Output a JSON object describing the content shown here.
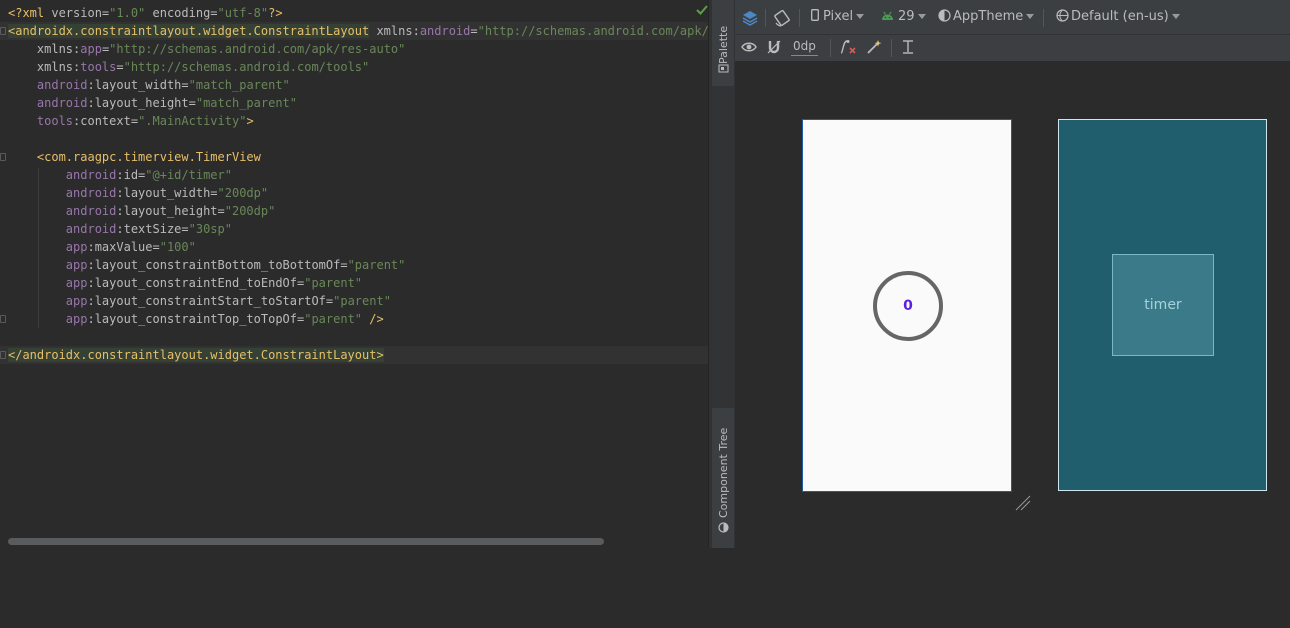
{
  "editor": {
    "lines": [
      [
        {
          "t": "<?xml ",
          "c": "t-pi"
        },
        {
          "t": "version=",
          "c": "t-attr"
        },
        {
          "t": "\"1.0\"",
          "c": "t-val"
        },
        {
          "t": " encoding=",
          "c": "t-attr"
        },
        {
          "t": "\"utf-8\"",
          "c": "t-val"
        },
        {
          "t": "?>",
          "c": "t-pi"
        }
      ],
      [
        {
          "t": "<androidx.constraintlayout.widget.ConstraintLayout",
          "c": "t-tag tag-hl"
        },
        {
          "t": " xmlns:",
          "c": "t-attr"
        },
        {
          "t": "android",
          "c": "t-ns"
        },
        {
          "t": "=",
          "c": "t-attr"
        },
        {
          "t": "\"http://schemas.android.com/apk/res",
          "c": "t-val"
        }
      ],
      [
        {
          "t": "    xmlns:",
          "c": "t-attr"
        },
        {
          "t": "app",
          "c": "t-ns"
        },
        {
          "t": "=",
          "c": "t-attr"
        },
        {
          "t": "\"http://schemas.android.com/apk/res-auto\"",
          "c": "t-val"
        }
      ],
      [
        {
          "t": "    xmlns:",
          "c": "t-attr"
        },
        {
          "t": "tools",
          "c": "t-ns"
        },
        {
          "t": "=",
          "c": "t-attr"
        },
        {
          "t": "\"http://schemas.android.com/tools\"",
          "c": "t-val"
        }
      ],
      [
        {
          "t": "    ",
          "c": "t-attr"
        },
        {
          "t": "android",
          "c": "t-ns"
        },
        {
          "t": ":layout_width=",
          "c": "t-attr"
        },
        {
          "t": "\"match_parent\"",
          "c": "t-val"
        }
      ],
      [
        {
          "t": "    ",
          "c": "t-attr"
        },
        {
          "t": "android",
          "c": "t-ns"
        },
        {
          "t": ":layout_height=",
          "c": "t-attr"
        },
        {
          "t": "\"match_parent\"",
          "c": "t-val"
        }
      ],
      [
        {
          "t": "    ",
          "c": "t-attr"
        },
        {
          "t": "tools",
          "c": "t-ns"
        },
        {
          "t": ":context=",
          "c": "t-attr"
        },
        {
          "t": "\".MainActivity\"",
          "c": "t-val"
        },
        {
          "t": ">",
          "c": "t-tag"
        }
      ],
      [],
      [
        {
          "t": "    ",
          "c": "t-attr"
        },
        {
          "t": "<com.raagpc.timerview.TimerView",
          "c": "t-tag"
        }
      ],
      [
        {
          "t": "        ",
          "c": "t-attr"
        },
        {
          "t": "android",
          "c": "t-ns"
        },
        {
          "t": ":id=",
          "c": "t-attr"
        },
        {
          "t": "\"@+id/timer\"",
          "c": "t-val"
        }
      ],
      [
        {
          "t": "        ",
          "c": "t-attr"
        },
        {
          "t": "android",
          "c": "t-ns"
        },
        {
          "t": ":layout_width=",
          "c": "t-attr"
        },
        {
          "t": "\"200dp\"",
          "c": "t-val"
        }
      ],
      [
        {
          "t": "        ",
          "c": "t-attr"
        },
        {
          "t": "android",
          "c": "t-ns"
        },
        {
          "t": ":layout_height=",
          "c": "t-attr"
        },
        {
          "t": "\"200dp\"",
          "c": "t-val"
        }
      ],
      [
        {
          "t": "        ",
          "c": "t-attr"
        },
        {
          "t": "android",
          "c": "t-ns"
        },
        {
          "t": ":textSize=",
          "c": "t-attr"
        },
        {
          "t": "\"30sp\"",
          "c": "t-val"
        }
      ],
      [
        {
          "t": "        ",
          "c": "t-attr"
        },
        {
          "t": "app",
          "c": "t-ns"
        },
        {
          "t": ":maxValue=",
          "c": "t-attr"
        },
        {
          "t": "\"100\"",
          "c": "t-val"
        }
      ],
      [
        {
          "t": "        ",
          "c": "t-attr"
        },
        {
          "t": "app",
          "c": "t-ns"
        },
        {
          "t": ":layout_constraintBottom_toBottomOf=",
          "c": "t-attr"
        },
        {
          "t": "\"parent\"",
          "c": "t-val"
        }
      ],
      [
        {
          "t": "        ",
          "c": "t-attr"
        },
        {
          "t": "app",
          "c": "t-ns"
        },
        {
          "t": ":layout_constraintEnd_toEndOf=",
          "c": "t-attr"
        },
        {
          "t": "\"parent\"",
          "c": "t-val"
        }
      ],
      [
        {
          "t": "        ",
          "c": "t-attr"
        },
        {
          "t": "app",
          "c": "t-ns"
        },
        {
          "t": ":layout_constraintStart_toStartOf=",
          "c": "t-attr"
        },
        {
          "t": "\"parent\"",
          "c": "t-val"
        }
      ],
      [
        {
          "t": "        ",
          "c": "t-attr"
        },
        {
          "t": "app",
          "c": "t-ns"
        },
        {
          "t": ":layout_constraintTop_toTopOf=",
          "c": "t-attr"
        },
        {
          "t": "\"parent\"",
          "c": "t-val"
        },
        {
          "t": " />",
          "c": "t-tag"
        }
      ],
      [],
      [
        {
          "t": "</androidx.constraintlayout.widget.ConstraintLayout>",
          "c": "t-tag tag-hl"
        }
      ]
    ]
  },
  "side_panel": {
    "palette_label": "Palette",
    "component_tree_label": "Component Tree"
  },
  "toolbar": {
    "device": "Pixel",
    "api_level": "29",
    "theme": "AppTheme",
    "locale": "Default (en-us)",
    "margin_default": "0dp"
  },
  "preview": {
    "timer_value": "0",
    "blueprint_label": "timer"
  },
  "colors": {
    "editor_bg": "#2b2b2b",
    "panel_bg": "#3c3f41",
    "blueprint_bg": "#205d6d",
    "timer_text": "#5a1fe0"
  },
  "icons": {
    "status": "checkmark-icon",
    "design_surface": "layers-icon",
    "orientation": "rotate-icon",
    "device": "phone-icon",
    "api": "android-icon",
    "theme": "theme-icon",
    "locale": "globe-icon"
  }
}
